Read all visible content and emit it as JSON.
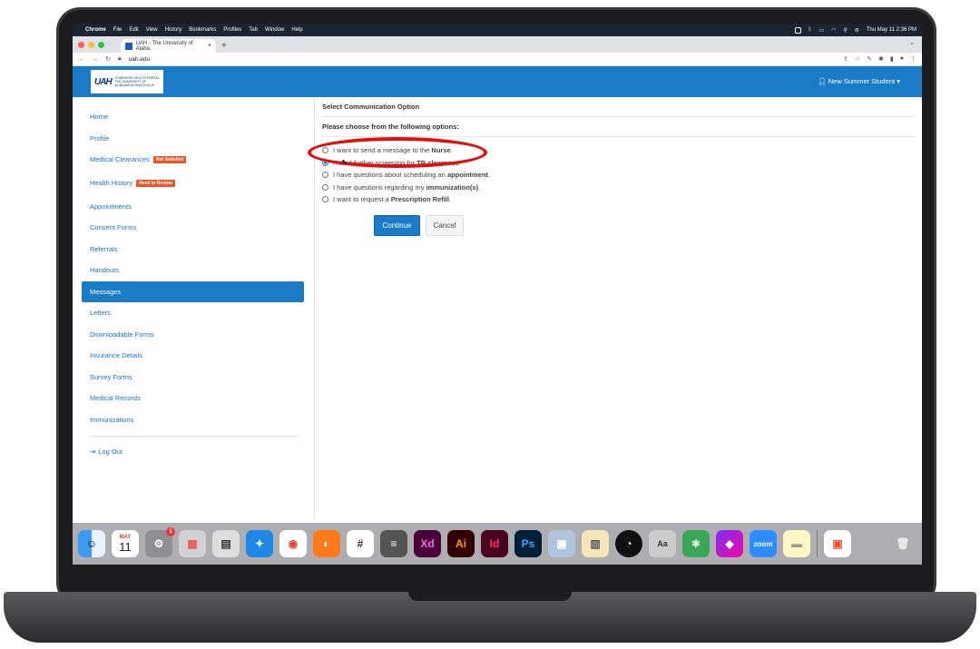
{
  "menubar": {
    "items": [
      "Chrome",
      "File",
      "Edit",
      "View",
      "History",
      "Bookmarks",
      "Profiles",
      "Tab",
      "Window",
      "Help"
    ],
    "clock": "Thu May 11  2:36 PM"
  },
  "browser": {
    "tab_title": "UAH - The University of Alaba",
    "url": "uah.edu"
  },
  "site": {
    "logo_text": "CHARGERS HEALTH PORTAL",
    "logo_sub": "THE UNIVERSITY OF ALABAMA IN HUNTSVILLE",
    "user": "New Summer Student"
  },
  "sidebar": {
    "items": [
      {
        "label": "Home"
      },
      {
        "label": "Profile"
      },
      {
        "label": "Medical Clearances",
        "badge": "Not Satisfied"
      },
      {
        "label": "Health History",
        "badge": "Need to Review"
      },
      {
        "label": "Appointments"
      },
      {
        "label": "Consent Forms"
      },
      {
        "label": "Referrals"
      },
      {
        "label": "Handouts"
      },
      {
        "label": "Messages"
      },
      {
        "label": "Letters"
      },
      {
        "label": "Downloadable Forms"
      },
      {
        "label": "Insurance Details"
      },
      {
        "label": "Survey Forms"
      },
      {
        "label": "Medical Records"
      },
      {
        "label": "Immunizations"
      }
    ],
    "logout": "Log Out"
  },
  "main": {
    "title": "Select Communication Option",
    "subtitle": "Please choose from the following options:",
    "options": [
      {
        "pre": "I want to send a message to the ",
        "bold": "Nurse",
        "post": "."
      },
      {
        "pre": "I need further screening for ",
        "bold": "TB clearance",
        "post": "."
      },
      {
        "pre": "I have questions about scheduling an ",
        "bold": "appointment",
        "post": "."
      },
      {
        "pre": "I have questions regarding my ",
        "bold": "immunization(s)",
        "post": "."
      },
      {
        "pre": "I want to request a ",
        "bold": "Prescription Refill",
        "post": "."
      }
    ],
    "continue_label": "Continue",
    "cancel_label": "Cancel"
  },
  "dock": {
    "calendar_month": "MAY",
    "calendar_day": "11",
    "settings_badge": "1",
    "xd": "Xd",
    "ai": "Ai",
    "id": "Id",
    "ps": "Ps",
    "zoom": "zoom"
  }
}
